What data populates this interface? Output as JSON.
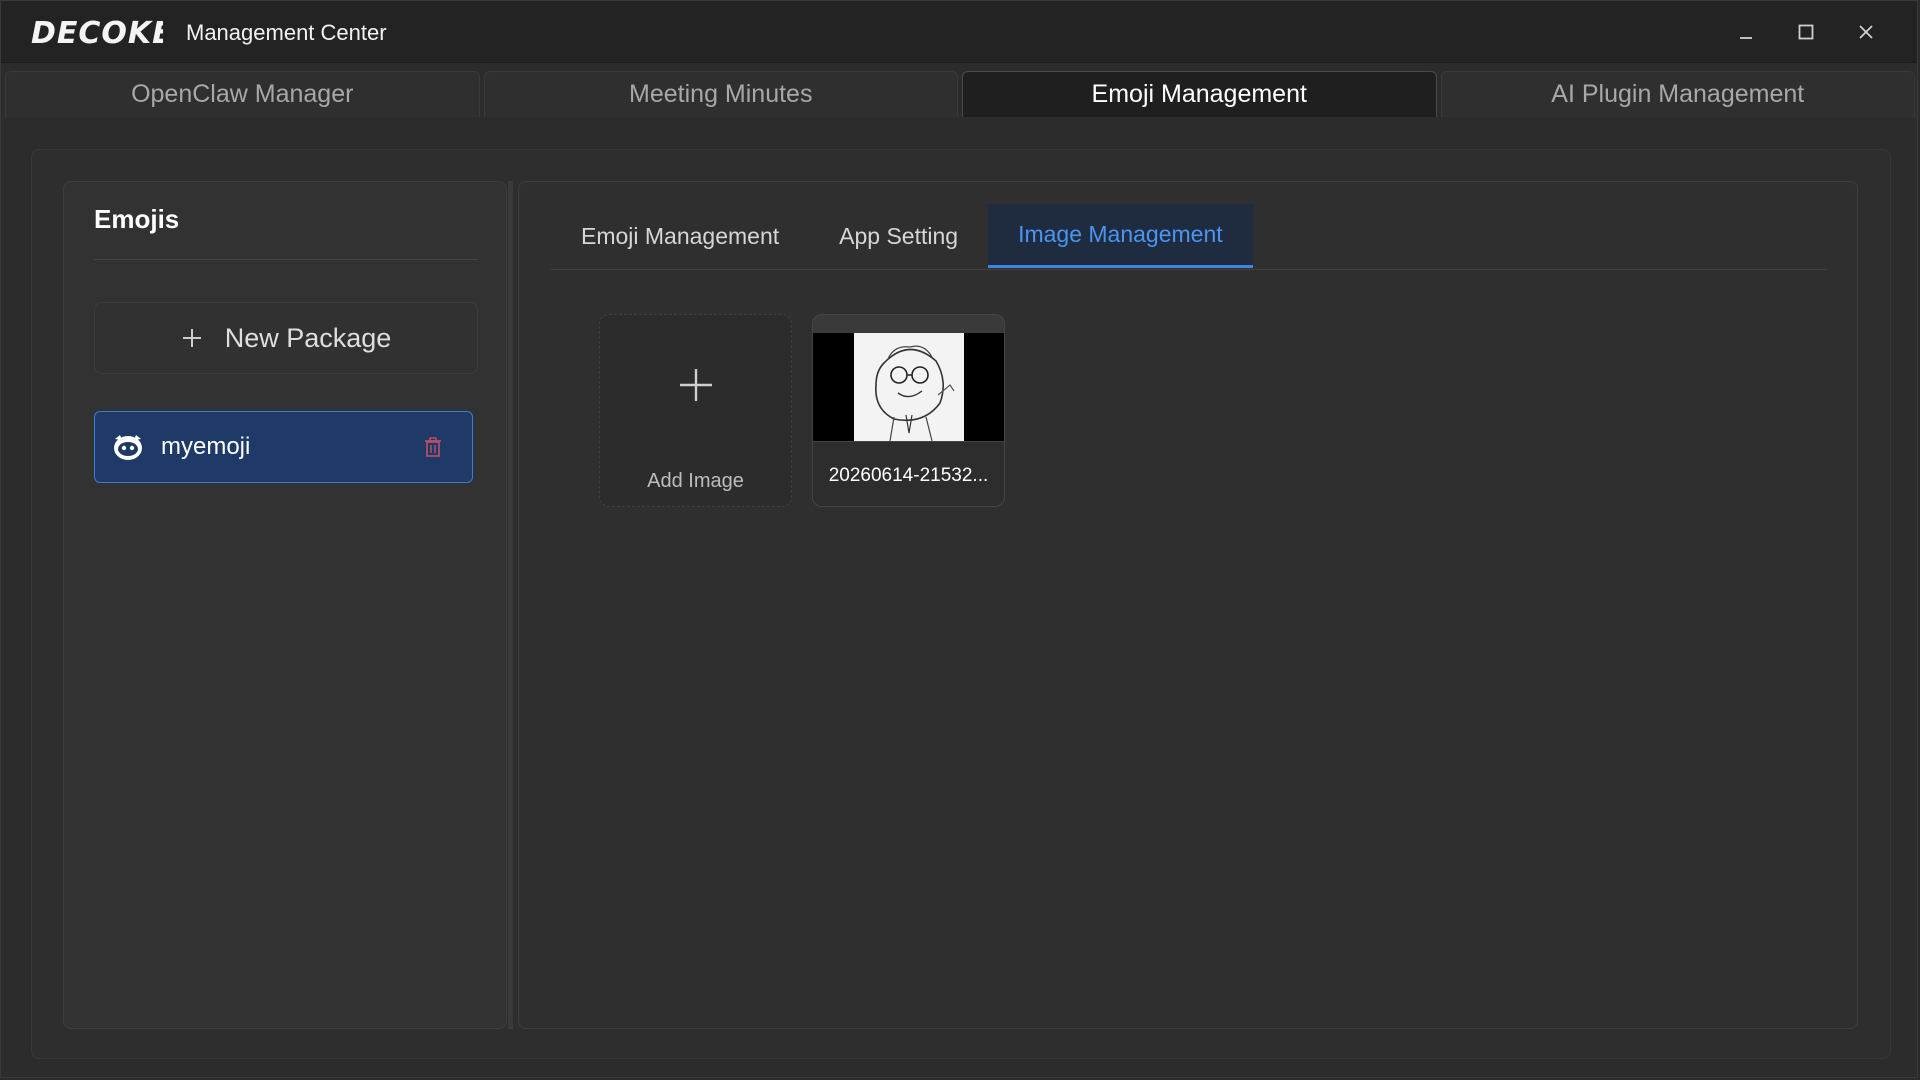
{
  "window": {
    "logo_text": "DECOKE",
    "title": "Management Center"
  },
  "top_tabs": [
    {
      "label": "OpenClaw Manager",
      "active": false
    },
    {
      "label": "Meeting Minutes",
      "active": false
    },
    {
      "label": "Emoji Management",
      "active": true
    },
    {
      "label": "AI Plugin Management",
      "active": false
    }
  ],
  "sidebar": {
    "title": "Emojis",
    "new_package_label": "New Package",
    "packages": [
      {
        "label": "myemoji",
        "icon": "emoji-face-icon",
        "selected": true
      }
    ]
  },
  "sub_tabs": [
    {
      "label": "Emoji Management",
      "active": false
    },
    {
      "label": "App Setting",
      "active": false
    },
    {
      "label": "Image Management",
      "active": true
    }
  ],
  "images": {
    "add_label": "Add Image",
    "items": [
      {
        "caption": "20260614-21532..."
      }
    ]
  },
  "colors": {
    "accent": "#3d86e6",
    "selected_bg": "#1f3a66",
    "delete_icon": "#c0506a"
  }
}
